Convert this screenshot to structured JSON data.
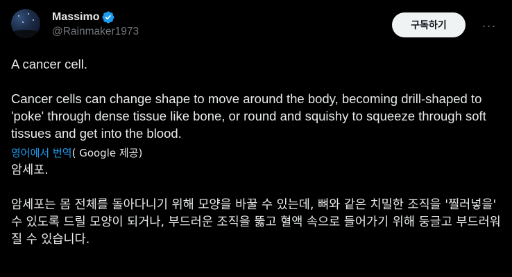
{
  "author": {
    "display_name": "Massimo",
    "handle": "@Rainmaker1973",
    "verified_icon": "verified-badge-icon",
    "avatar_icon": "avatar-night-sky"
  },
  "actions": {
    "subscribe_label": "구독하기",
    "more_label": "···"
  },
  "tweet": {
    "line1": "A cancer cell.",
    "line2": "Cancer cells can change shape to move around the body, becoming drill-shaped to 'poke' through dense tissue like bone, or round and squishy to squeeze through soft tissues and get into the blood."
  },
  "translation": {
    "link_label": "영어에서 번역",
    "by_label": "( Google 제공)",
    "line1": "암세포.",
    "line2": "암세포는 몸 전체를 돌아다니기 위해 모양을 바꿀 수 있는데, 뼈와 같은 치밀한 조직을 '찔러넣을' 수 있도록 드릴 모양이 되거나, 부드러운 조직을 뚫고 혈액 속으로 들어가기 위해 둥글고 부드러워질 수 있습니다."
  },
  "colors": {
    "background": "#000000",
    "text": "#e7e9ea",
    "secondary": "#71767b",
    "link": "#1d9bf0",
    "verified": "#1d9bf0",
    "button_bg": "#eff3f4"
  }
}
